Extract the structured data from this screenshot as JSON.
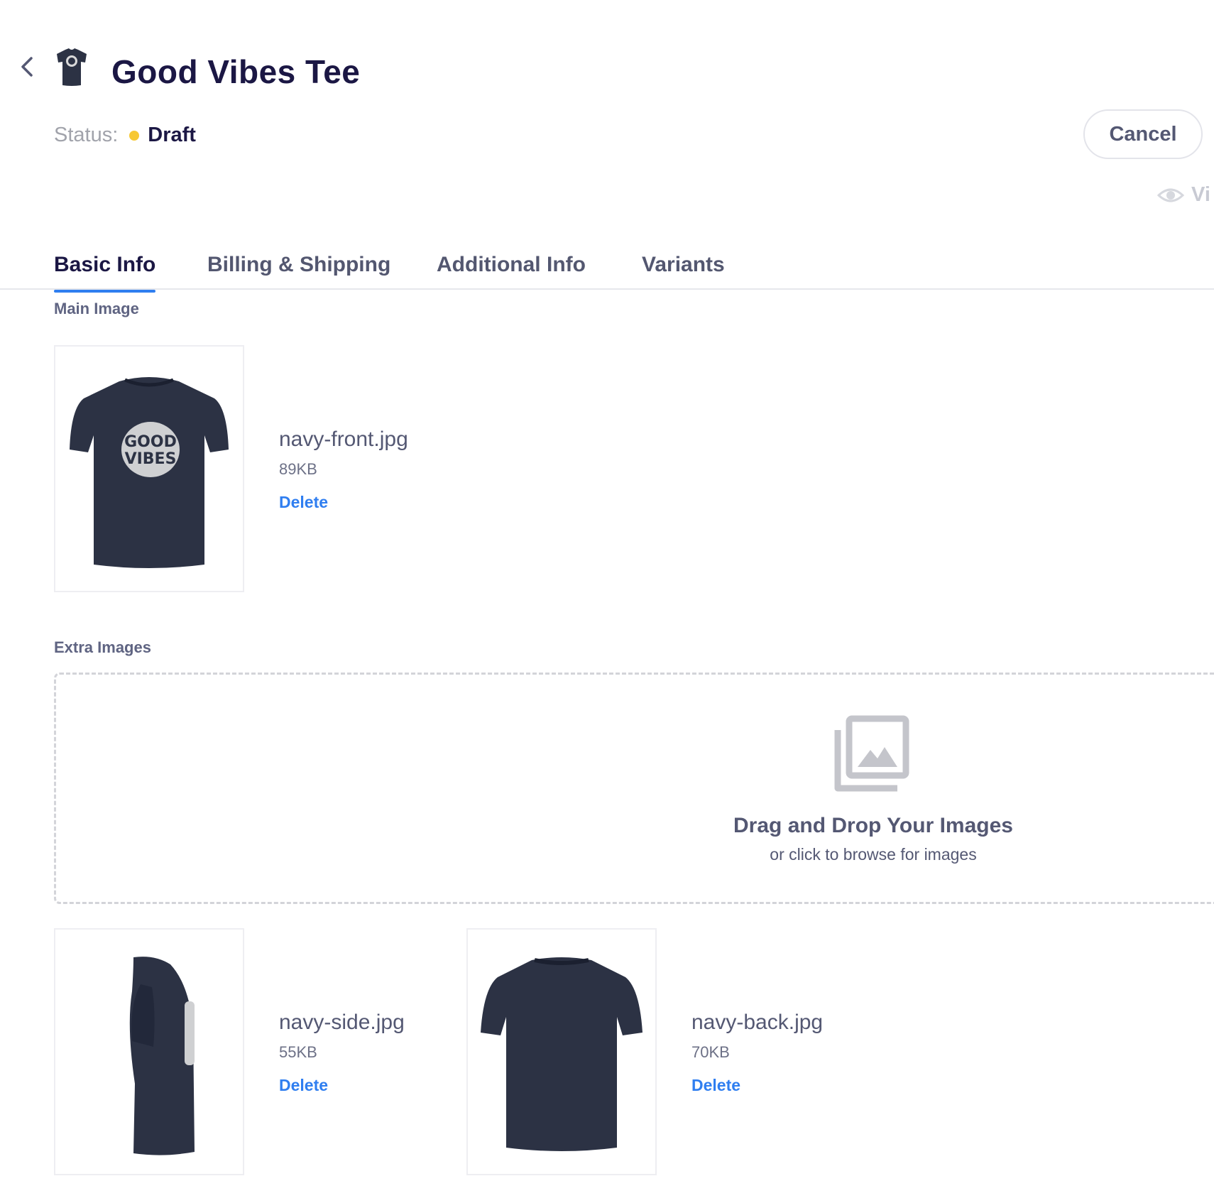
{
  "header": {
    "title": "Good Vibes Tee",
    "status_label": "Status:",
    "status_value": "Draft",
    "status_color": "#f7c833",
    "cancel_label": "Cancel",
    "view_label": "Vi",
    "back_icon": "chevron-left-icon",
    "view_icon": "eye-icon"
  },
  "tabs": [
    {
      "label": "Basic Info",
      "active": true
    },
    {
      "label": "Billing & Shipping",
      "active": false
    },
    {
      "label": "Additional Info",
      "active": false
    },
    {
      "label": "Variants",
      "active": false
    }
  ],
  "main_image": {
    "section_label": "Main Image",
    "file": {
      "name": "navy-front.jpg",
      "size": "89KB",
      "delete_label": "Delete",
      "graphic_text": "GOOD VIBES"
    }
  },
  "extra_images": {
    "section_label": "Extra Images",
    "dropzone": {
      "icon": "image-gallery-icon",
      "title": "Drag and Drop Your Images",
      "subtitle": "or click to browse for images"
    },
    "files": [
      {
        "name": "navy-side.jpg",
        "size": "55KB",
        "delete_label": "Delete"
      },
      {
        "name": "navy-back.jpg",
        "size": "70KB",
        "delete_label": "Delete"
      }
    ]
  },
  "colors": {
    "accent": "#2f7ef0",
    "title": "#1b1744",
    "shirt": "#2c3244",
    "draft_dot": "#f7c833"
  }
}
